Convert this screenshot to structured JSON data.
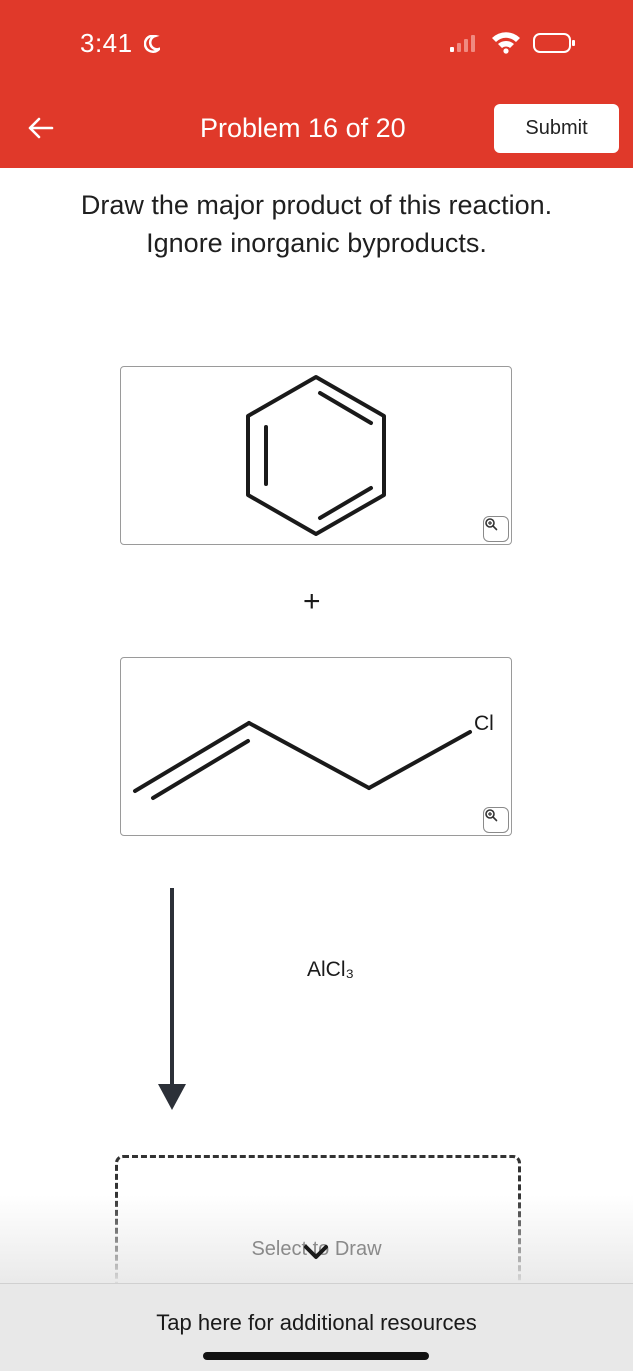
{
  "status_bar": {
    "time": "3:41"
  },
  "header": {
    "title": "Problem 16 of 20",
    "submit_label": "Submit"
  },
  "prompt": {
    "line1": "Draw the major product of this reaction.",
    "line2": "Ignore inorganic byproducts."
  },
  "reactants": {
    "plus": "+",
    "second_label": "Cl"
  },
  "reagent": {
    "label": "AlCl₃"
  },
  "answer": {
    "placeholder": "Select to Draw"
  },
  "footer": {
    "resources_label": "Tap here for additional resources"
  }
}
